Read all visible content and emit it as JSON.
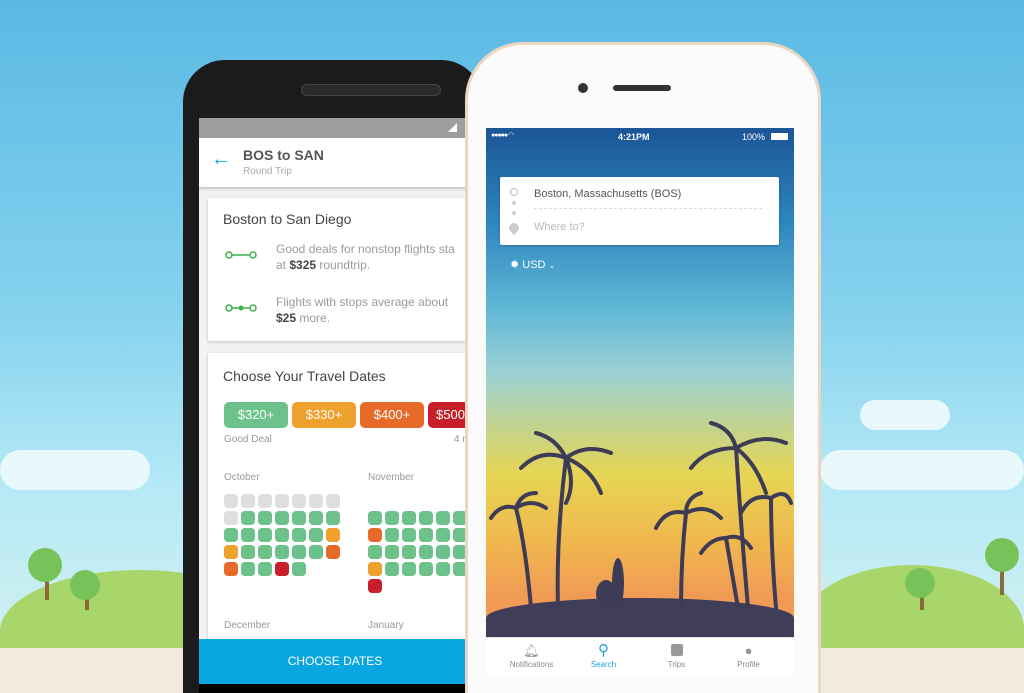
{
  "android": {
    "header": {
      "title": "BOS to SAN",
      "subtitle": "Round Trip"
    },
    "insight_card": {
      "title": "Boston to San Diego",
      "nonstop": {
        "text_before": "Good deals for nonstop flights sta",
        "text_line2_before": "at ",
        "price": "$325",
        "text_after": " roundtrip."
      },
      "stops": {
        "text_before": "Flights with stops average about",
        "price": "$25",
        "text_after": " more."
      }
    },
    "dates_card": {
      "title": "Choose Your Travel Dates",
      "legend": [
        {
          "label": "$320+",
          "color": "#6cc28a"
        },
        {
          "label": "$330+",
          "color": "#f0a02c"
        },
        {
          "label": "$400+",
          "color": "#e76a28"
        },
        {
          "label": "$500",
          "color": "#c8202a"
        }
      ],
      "legend_left_caption": "Good Deal",
      "legend_right_caption": "4 r",
      "months": [
        {
          "name": "October",
          "rows": [
            "xxxxxxx",
            "xgggggg",
            "ggggggo",
            "ogggggr",
            "rggRg"
          ]
        },
        {
          "name": "November",
          "rows": [
            "ggggggo",
            "rgggggg",
            "ggggggg",
            "ogggggg",
            "R"
          ]
        },
        {
          "name": "December"
        },
        {
          "name": "January"
        }
      ],
      "cell_colors": {
        "x": "#dedede",
        "g": "#6cc28a",
        "o": "#f0a02c",
        "r": "#e76a28",
        "R": "#c8202a"
      }
    },
    "cta": "CHOOSE DATES",
    "accent": "#0aa6e2"
  },
  "iphone": {
    "status": {
      "time": "4:21PM",
      "battery": "100%"
    },
    "search": {
      "origin": "Boston, Massachusetts (BOS)",
      "destination_placeholder": "Where to?"
    },
    "currency": "USD",
    "tabs": [
      {
        "label": "Notifications",
        "icon": "bell-icon",
        "active": false
      },
      {
        "label": "Search",
        "icon": "search-icon",
        "active": true
      },
      {
        "label": "Trips",
        "icon": "suitcase-icon",
        "active": false
      },
      {
        "label": "Profile",
        "icon": "person-icon",
        "active": false
      }
    ],
    "active_color": "#1aa3e0"
  }
}
